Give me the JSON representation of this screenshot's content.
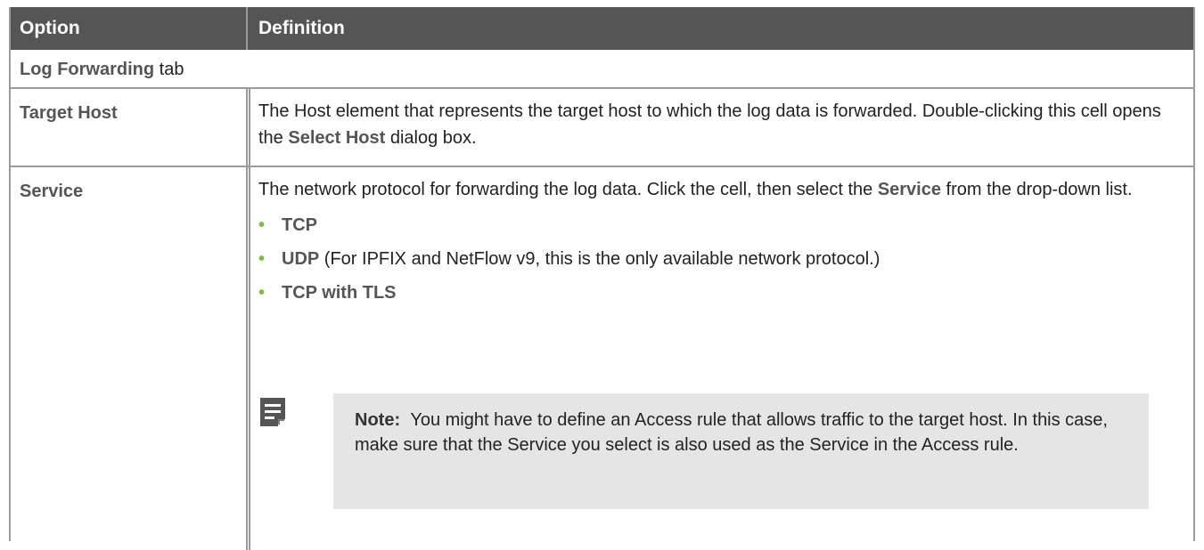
{
  "table": {
    "headers": {
      "option": "Option",
      "definition": "Definition"
    },
    "section": {
      "bold": "Log Forwarding",
      "rest": " tab"
    },
    "rows": [
      {
        "option": "Target Host",
        "definition": {
          "text1": "The Host element that represents the target host to which the log data is forwarded. Double-clicking this cell opens the ",
          "bold1": "Select Host",
          "text2": " dialog box."
        }
      },
      {
        "option": "Service",
        "definition": {
          "text1": "The network protocol for forwarding the log data. Click the cell, then select the ",
          "bold1": "Service",
          "text2": " from the drop-down list.",
          "bullets": [
            {
              "bold": "TCP",
              "rest": ""
            },
            {
              "bold": "UDP",
              "rest": " (For IPFIX and NetFlow v9, this is the only available network protocol.)"
            },
            {
              "bold": "TCP with TLS",
              "rest": ""
            }
          ],
          "note": {
            "label": "Note:",
            "text": "You might have to define an Access rule that allows traffic to the target host. In this case, make sure that the Service you select is also used as the Service in the Access rule."
          }
        }
      }
    ]
  },
  "colors": {
    "header_bg": "#555555",
    "header_text": "#ffffff",
    "bold_text": "#555555",
    "bullet": "#7bbf3c",
    "note_bg": "#e5e5e5",
    "border": "#9a9a9a"
  },
  "icons": {
    "note": "note-icon"
  }
}
